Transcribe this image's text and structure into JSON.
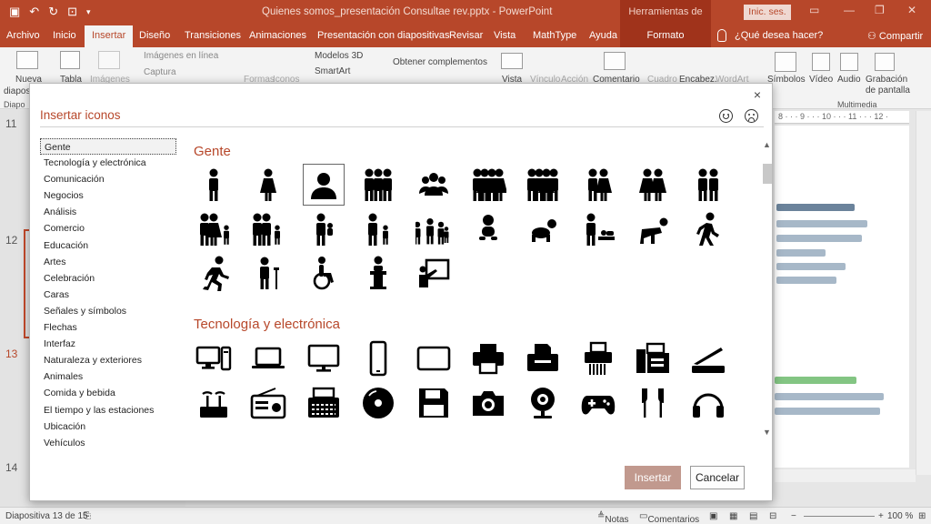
{
  "window": {
    "doc_title": "Quienes somos_presentación Consultae rev.pptx  -  PowerPoint",
    "context_tools": "Herramientas de dibujo",
    "signin_label": "Inic. ses."
  },
  "tabs": {
    "archivo": "Archivo",
    "inicio": "Inicio",
    "insertar": "Insertar",
    "diseno": "Diseño",
    "transiciones": "Transiciones",
    "animaciones": "Animaciones",
    "presentacion": "Presentación con diapositivas",
    "revisar": "Revisar",
    "vista": "Vista",
    "mathtype": "MathType",
    "ayuda": "Ayuda",
    "formato": "Formato",
    "tell_me": "¿Qué desea hacer?",
    "compartir": "Compartir"
  },
  "ribbon": {
    "nueva": "Nueva",
    "diapos": "diapos",
    "tabla": "Tabla",
    "imagenes": "Imágenes",
    "imagenes_linea": "Imágenes en línea",
    "captura": "Captura",
    "formas": "Formas",
    "iconos": "Iconos",
    "modelos3d": "Modelos 3D",
    "smartart": "SmartArt",
    "complementos": "Obtener complementos",
    "vista": "Vista",
    "vinculo": "Vínculo",
    "accion": "Acción",
    "comentario": "Comentario",
    "cuadro": "Cuadro",
    "encabez": "Encabez.",
    "wordart": "WordArt",
    "simbolos": "Símbolos",
    "video": "Vídeo",
    "audio": "Audio",
    "grabacion": "Grabación",
    "de_pantalla": "de pantalla",
    "group_diapo": "Diapo",
    "group_multimedia": "Multimedia"
  },
  "thumbnails": {
    "nums": [
      "11",
      "12",
      "13",
      "14"
    ]
  },
  "ruler_marks": "8 · · · 9 · · · 10 · · · 11 · · · 12 ·",
  "statusbar": {
    "slide_info": "Diapositiva 13 de 15",
    "notas": "Notas",
    "comentarios": "Comentarios",
    "zoom": "100 %"
  },
  "dialog": {
    "title": "Insertar iconos",
    "close": "×",
    "categories": [
      "Gente",
      "Tecnología y electrónica",
      "Comunicación",
      "Negocios",
      "Análisis",
      "Comercio",
      "Educación",
      "Artes",
      "Celebración",
      "Caras",
      "Señales y símbolos",
      "Flechas",
      "Interfaz",
      "Naturaleza y exteriores",
      "Animales",
      "Comida y bebida",
      "El tiempo y las estaciones",
      "Ubicación",
      "Vehículos"
    ],
    "selected_category": "Gente",
    "section_people": "Gente",
    "section_tech": "Tecnología y electrónica",
    "people_icons": [
      "man-icon",
      "woman-icon",
      "user-icon",
      "group-icon",
      "team-icon",
      "family-icon",
      "children-icon",
      "couple-icon",
      "women-couple-icon",
      "men-couple-icon",
      "family-child-icon",
      "family-children-icon",
      "parent-baby-icon",
      "father-son-icon",
      "people-group-icon",
      "baby-icon",
      "crawling-baby-icon",
      "diaper-change-icon",
      "crawling-person-icon",
      "walking-icon",
      "running-icon",
      "elderly-icon",
      "wheelchair-icon",
      "speaker-podium-icon",
      "presentation-icon"
    ],
    "tech_icons": [
      "desktop-computer-icon",
      "laptop-icon",
      "monitor-icon",
      "smartphone-icon",
      "tablet-icon",
      "printer-icon",
      "printer-paper-icon",
      "shredder-icon",
      "fax-icon",
      "scanner-icon",
      "router-icon",
      "radio-icon",
      "typewriter-icon",
      "cd-icon",
      "floppy-disk-icon",
      "camera-icon",
      "webcam-icon",
      "gamepad-icon",
      "earbuds-icon",
      "headphones-icon"
    ],
    "insert_label": "Insertar",
    "cancel_label": "Cancelar",
    "insert_color": "#c1998e",
    "accent_color": "#b7472a"
  }
}
